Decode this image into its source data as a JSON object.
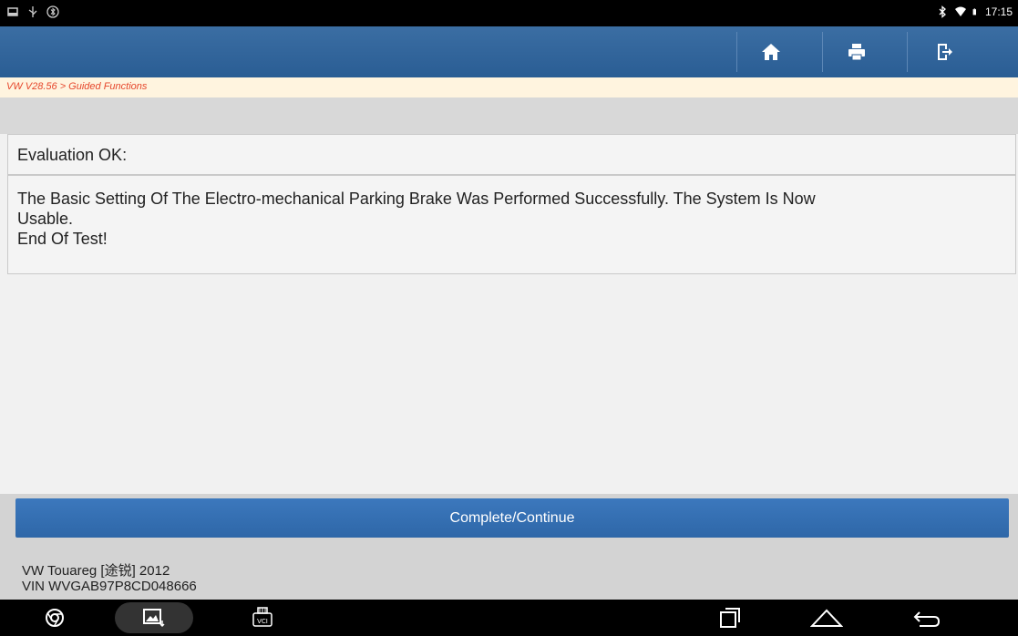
{
  "status_bar": {
    "time": "17:15",
    "left_icons": [
      "screenshot-icon",
      "usb-icon",
      "bluetooth-app-icon"
    ],
    "right_icons": [
      "bluetooth-icon",
      "wifi-icon",
      "battery-icon"
    ]
  },
  "header": {
    "buttons": [
      "home-icon",
      "print-icon",
      "exit-icon"
    ]
  },
  "breadcrumb": "VW V28.56 > Guided Functions",
  "messages": {
    "title": "Evaluation OK:",
    "body_line1": "The Basic Setting Of The Electro-mechanical Parking Brake Was Performed Successfully. The System Is Now",
    "body_line2": "Usable.",
    "body_line3": "End Of Test!"
  },
  "action_button": "Complete/Continue",
  "vehicle": {
    "model": "VW Touareg [途锐] 2012",
    "vin": "VIN WVGAB97P8CD048666"
  },
  "nav_bar": {
    "left_icons": [
      "chrome-icon",
      "gallery-icon",
      "vci-icon"
    ],
    "right_icons": [
      "recent-apps-icon",
      "home-outline-icon",
      "back-icon"
    ],
    "vci_label": "VCI"
  },
  "colors": {
    "header_blue": "#2a5d94",
    "breadcrumb_red": "#e6462b",
    "button_blue": "#3c78bd"
  }
}
